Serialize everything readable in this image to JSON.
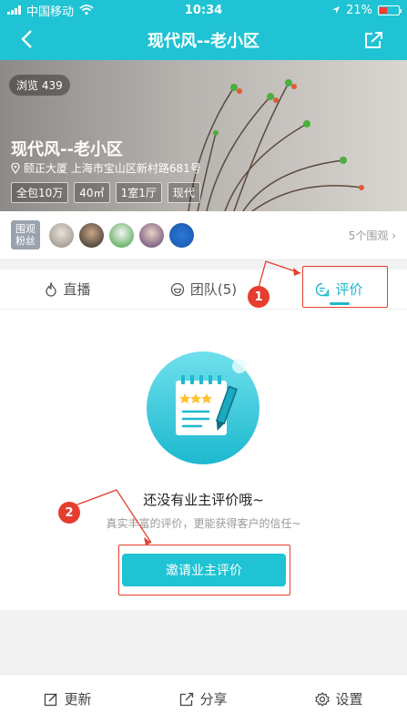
{
  "status": {
    "carrier": "中国移动",
    "time": "10:34",
    "battery": "21%"
  },
  "nav": {
    "title": "现代风--老小区"
  },
  "hero": {
    "views": "浏览 439",
    "title": "现代风--老小区",
    "address": "颐正大厦 上海市宝山区新村路681号",
    "tags": [
      "全包10万",
      "40㎡",
      "1室1厅",
      "现代"
    ]
  },
  "fans": {
    "badge_line1": "围观",
    "badge_line2": "粉丝",
    "count": "5个围观"
  },
  "tabs": [
    {
      "label": "直播",
      "icon": "fire-icon"
    },
    {
      "label": "团队(5)",
      "icon": "smiley-icon"
    },
    {
      "label": "评价",
      "icon": "comment-icon"
    }
  ],
  "empty": {
    "title": "还没有业主评价哦~",
    "subtitle": "真实丰富的评价，更能获得客户的信任~",
    "button": "邀请业主评价"
  },
  "markers": [
    "1",
    "2"
  ],
  "bottom": [
    {
      "label": "更新",
      "icon": "edit-icon"
    },
    {
      "label": "分享",
      "icon": "share-icon"
    },
    {
      "label": "设置",
      "icon": "gear-icon"
    }
  ],
  "colors": {
    "accent": "#1fc3d3",
    "annotation": "#e53e2f"
  }
}
